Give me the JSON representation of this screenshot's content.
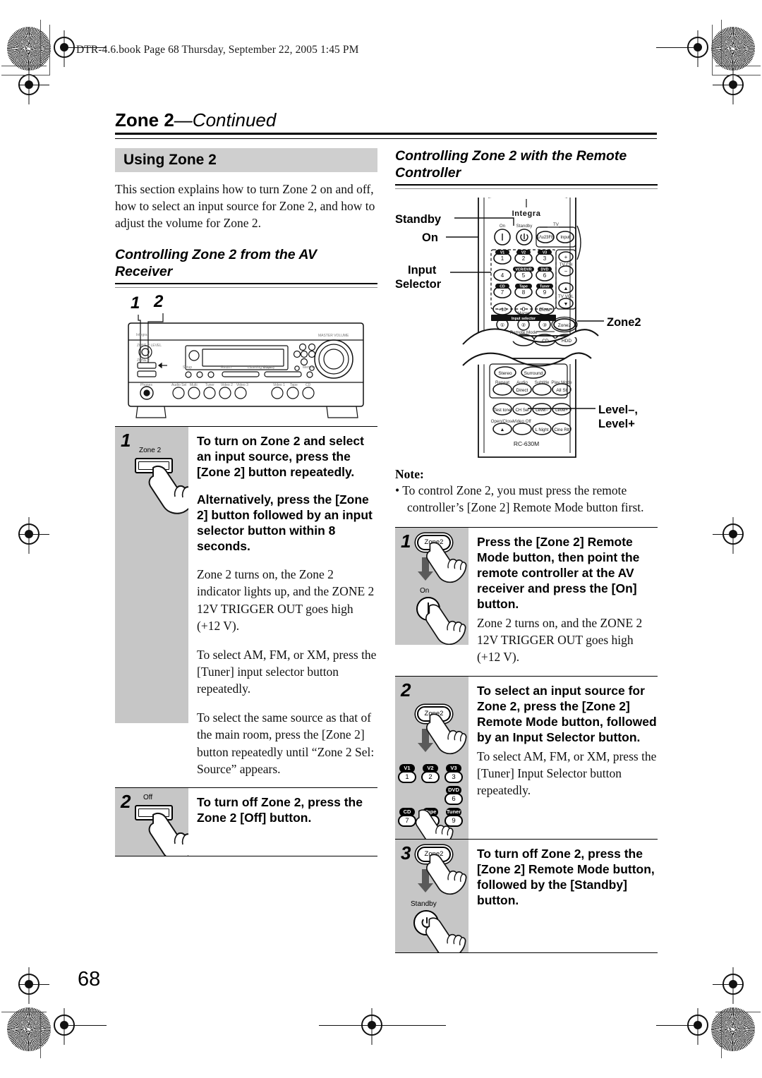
{
  "running_head": "DTR-4.6.book  Page 68  Thursday, September 22, 2005  1:45 PM",
  "chapter": {
    "title_bold": "Zone 2",
    "title_italic": "—Continued"
  },
  "folio": "68",
  "left_column": {
    "section_heading": "Using Zone 2",
    "intro": "This section explains how to turn Zone 2 on and off, how to select an input source for Zone 2, and how to adjust the volume for Zone 2.",
    "sub_heading": "Controlling Zone 2 from the AV Receiver",
    "receiver_figure": {
      "callout_1": "1",
      "callout_2": "2",
      "brand": "Integra"
    },
    "steps": [
      {
        "number": "1",
        "figure_label": "Zone 2",
        "title": "To turn on Zone 2 and select an input source, press the [Zone 2] button repeatedly.",
        "title2": "Alternatively, press the [Zone 2] button followed by an input selector button within 8 seconds.",
        "paragraphs": [
          "Zone 2 turns on, the Zone 2 indicator lights up, and the ZONE 2 12V TRIGGER OUT goes high (+12 V).",
          "To select AM, FM, or XM, press the [Tuner] input selector button repeatedly.",
          "To select the same source as that of the main room, press the [Zone 2] button repeatedly until “Zone 2 Sel: Source” appears."
        ]
      },
      {
        "number": "2",
        "figure_label": "Off",
        "title": "To turn off Zone 2, press the Zone 2 [Off] button.",
        "paragraphs": []
      }
    ]
  },
  "right_column": {
    "sub_heading_line1": "Controlling Zone 2 with the Remote",
    "sub_heading_line2": "Controller",
    "remote": {
      "brand": "Integra",
      "model": "RC-630M",
      "callouts": {
        "standby": "Standby",
        "on": "On",
        "input_selector_line1": "Input",
        "input_selector_line2": "Selector",
        "zone2": "Zone2",
        "level_line1": "Level–,",
        "level_line2": "Level+"
      },
      "labels": {
        "on": "On",
        "standby": "Standby",
        "tv": "TV",
        "tv_power": "1/①",
        "tv_input": "Input",
        "tv_ch": "TV CH",
        "tv_vol": "TV VOL",
        "macro": "Macro",
        "remote_mode": "Remote Mode",
        "input_selector": "Input selector",
        "plus10": "+10",
        "clear": "Clear"
      },
      "keypad": [
        {
          "key": "1",
          "tag": "V1"
        },
        {
          "key": "2",
          "tag": "V2"
        },
        {
          "key": "3",
          "tag": "V3"
        },
        {
          "key": "4",
          "tag": ""
        },
        {
          "key": "5",
          "tag": "VCR/DVR"
        },
        {
          "key": "6",
          "tag": "DVD"
        },
        {
          "key": "7",
          "tag": "CD"
        },
        {
          "key": "8",
          "tag": "Tape"
        },
        {
          "key": "9",
          "tag": "Tuner"
        }
      ],
      "macro_keys": [
        "1",
        "2",
        "3"
      ],
      "mode_keys": [
        "CD",
        "HDD"
      ],
      "zone2_key": "Zone2",
      "lower_row1": [
        "Stereo",
        "Surround"
      ],
      "lower_row2_labels": [
        "Repeat",
        "Audio",
        "Subtitle",
        "Play Mode"
      ],
      "lower_row2_keys": [
        "",
        "Direct",
        "",
        "All St"
      ],
      "lower_row3_keys": [
        "Test tone",
        "CH Sel",
        "Level–",
        "Level+"
      ],
      "lower_row4_labels": [
        "Open/Close",
        "Video Off"
      ],
      "lower_row4_keys": [
        "▲",
        "",
        "L Night",
        "Cine Rb"
      ]
    },
    "note": {
      "heading": "Note:",
      "items": [
        "To control Zone 2, you must press the remote controller’s [Zone 2] Remote Mode button first."
      ]
    },
    "steps": [
      {
        "number": "1",
        "fig_top_label": "Zone2",
        "fig_bottom_label": "On",
        "title": "Press the [Zone 2] Remote Mode button, then point the remote controller at the AV receiver and press the [On] button.",
        "paragraphs": [
          "Zone 2 turns on, and the ZONE 2 12V TRIGGER OUT goes high (+12 V)."
        ]
      },
      {
        "number": "2",
        "fig_top_label": "Zone2",
        "title": "To select an input source for Zone 2, press the [Zone 2] Remote Mode button, followed by an Input Selector button.",
        "paragraphs": [
          "To select AM, FM, or XM, press the [Tuner] Input Selector button repeatedly."
        ],
        "keypad": [
          {
            "key": "1",
            "tag": "V1"
          },
          {
            "key": "2",
            "tag": "V2"
          },
          {
            "key": "3",
            "tag": "V3"
          },
          {
            "key": "6",
            "tag": "DVD"
          },
          {
            "key": "7",
            "tag": "CD"
          },
          {
            "key": "8",
            "tag": "Tape"
          },
          {
            "key": "9",
            "tag": "Tuner"
          }
        ]
      },
      {
        "number": "3",
        "fig_top_label": "Zone2",
        "fig_bottom_label": "Standby",
        "title": "To turn off Zone 2, press the [Zone 2] Remote Mode button, followed by the [Standby] button.",
        "paragraphs": []
      }
    ]
  },
  "colors": {
    "gray_heading_bg": "#cfcfcf",
    "step_figure_bg": "#c6c6c6",
    "rule": "#000000",
    "arrow": "#5a5a5a"
  }
}
